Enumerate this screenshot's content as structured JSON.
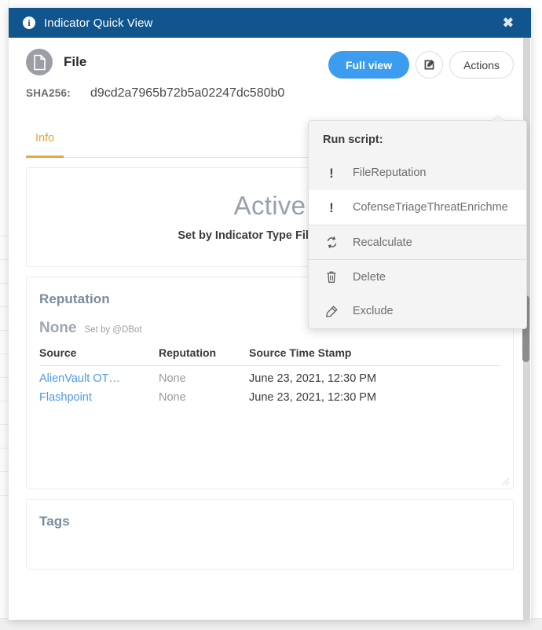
{
  "titlebar": {
    "icon": "info-circle-icon",
    "title": "Indicator Quick View",
    "close_label": "✖"
  },
  "indicator": {
    "avatar_icon": "file-document-icon",
    "type_label": "File",
    "hash_label": "SHA256:",
    "hash_value": "d9cd2a7965b72b5a02247dc580b0"
  },
  "header_buttons": {
    "full_view_label": "Full view",
    "edit_icon": "edit-pencil-square-icon",
    "actions_label": "Actions"
  },
  "tabs": [
    {
      "label": "Info",
      "active": true
    }
  ],
  "status_card": {
    "status": "Active",
    "subtitle": "Set by Indicator Type File on June"
  },
  "reputation_card": {
    "title": "Reputation",
    "verdict": "None",
    "set_by": "Set by @DBot",
    "columns": [
      "Source",
      "Reputation",
      "Source Time Stamp"
    ],
    "rows": [
      {
        "source": "AlienVault OT…",
        "reputation": "None",
        "timestamp": "June 23, 2021, 12:30 PM"
      },
      {
        "source": "Flashpoint",
        "reputation": "None",
        "timestamp": "June 23, 2021, 12:30 PM"
      }
    ]
  },
  "tags_card": {
    "title": "Tags"
  },
  "dropdown": {
    "heading": "Run script:",
    "items": [
      {
        "icon": "exclamation-icon",
        "label": "FileReputation",
        "hovered": false,
        "separator": false
      },
      {
        "icon": "exclamation-icon",
        "label": "CofenseTriageThreatEnrichme",
        "hovered": true,
        "separator": false
      },
      {
        "icon": "refresh-sync-icon",
        "label": "Recalculate",
        "hovered": false,
        "separator": true
      },
      {
        "icon": "trash-delete-icon",
        "label": "Delete",
        "hovered": false,
        "separator": true
      },
      {
        "icon": "brush-exclude-icon",
        "label": "Exclude",
        "hovered": false,
        "separator": false
      }
    ]
  },
  "colors": {
    "titlebar": "#10558d",
    "primary_button": "#3c9cf0",
    "tab_active": "#eda63f",
    "link": "#4d9ae8",
    "card_heading": "#7b8b9e"
  }
}
